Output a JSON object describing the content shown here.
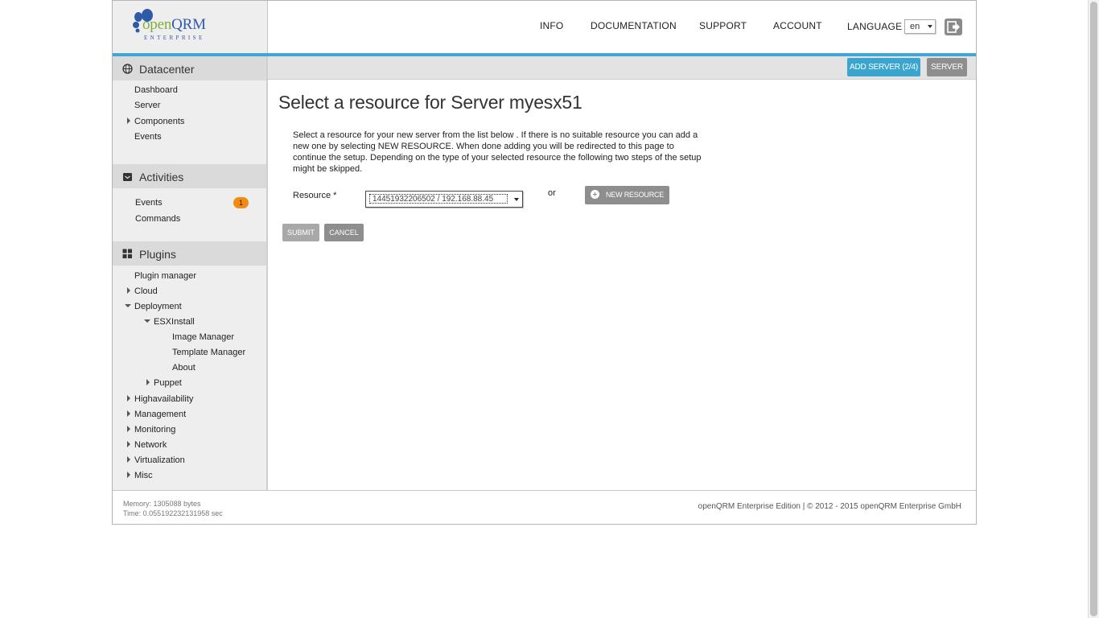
{
  "header": {
    "logo_brand": "openQRM",
    "logo_tagline": "ENTERPRISE",
    "nav": {
      "info": "INFO",
      "documentation": "DOCUMENTATION",
      "support": "SUPPORT",
      "account": "ACCOUNT",
      "language_label": "LANGUAGE",
      "language_value": "en"
    },
    "accent_color": "#3fa6d6"
  },
  "toolbar": {
    "add_server_label": "ADD SERVER (2/4)",
    "server_label": "SERVER"
  },
  "sidebar": {
    "datacenter": {
      "title": "Datacenter",
      "items": [
        "Dashboard",
        "Server",
        "Components",
        "Events"
      ]
    },
    "activities": {
      "title": "Activities",
      "items": [
        "Events",
        "Commands"
      ],
      "events_badge": "1"
    },
    "plugins": {
      "title": "Plugins",
      "items": {
        "plugin_manager": "Plugin manager",
        "cloud": "Cloud",
        "deployment": "Deployment",
        "esxinstall": "ESXInstall",
        "image_manager": "Image Manager",
        "template_manager": "Template Manager",
        "about": "About",
        "puppet": "Puppet",
        "highavailability": "Highavailability",
        "management": "Management",
        "monitoring": "Monitoring",
        "network": "Network",
        "virtualization": "Virtualization",
        "misc": "Misc"
      }
    }
  },
  "main": {
    "title": "Select a resource for Server myesx51",
    "description": "Select a resource for your new server from the list below . If there is no suitable resource you can add a new one by selecting NEW RESOURCE. When done adding you will be redirected to this page to continue the setup. Depending on the type of your selected resource the following two steps of the setup might be skipped.",
    "resource_label": "Resource *",
    "resource_value": "14451932206502 / 192.168.88.45",
    "or_text": "or",
    "new_resource_label": "NEW RESOURCE",
    "submit_label": "SUBMIT",
    "cancel_label": "CANCEL"
  },
  "footer": {
    "memory": "Memory: 1305088 bytes",
    "time": "Time: 0.055192232131958 sec",
    "copyright": "openQRM Enterprise Edition | © 2012 - 2015 openQRM Enterprise GmbH"
  }
}
